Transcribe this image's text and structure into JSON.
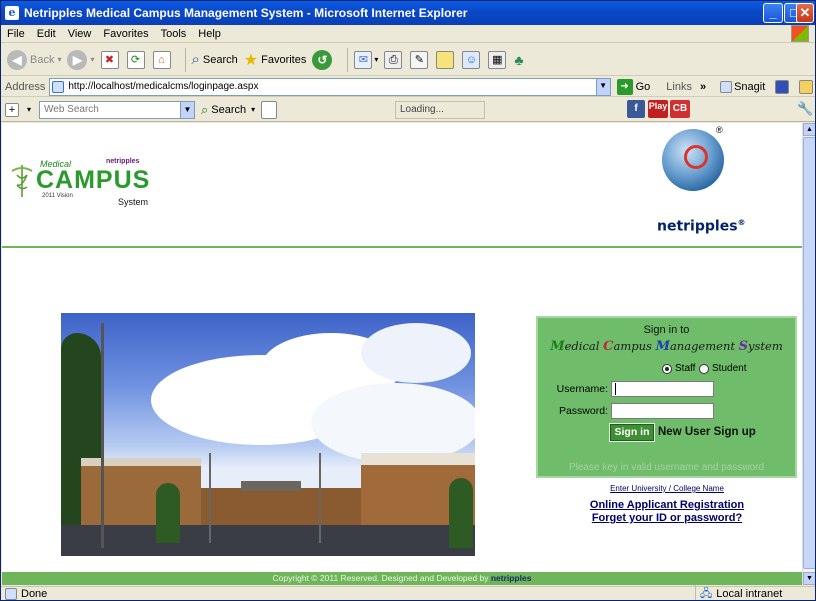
{
  "window": {
    "title": "Netripples Medical Campus Management System - Microsoft Internet Explorer",
    "minimize": "_",
    "maximize": "□",
    "close": "✕"
  },
  "menu": [
    "File",
    "Edit",
    "View",
    "Favorites",
    "Tools",
    "Help"
  ],
  "toolbar": {
    "back": "Back",
    "search": "Search",
    "favorites": "Favorites"
  },
  "address": {
    "label": "Address",
    "url": "http://localhost/medicalcms/loginpage.aspx",
    "go": "Go",
    "links": "Links",
    "more": "»",
    "snagit": "Snagit"
  },
  "searchbar": {
    "placeholder": "Web Search",
    "search": "Search",
    "loading": "Loading...",
    "play": "Play",
    "cb": "CB",
    "fb": "f"
  },
  "page": {
    "logo": {
      "medical": "Medical",
      "netripples": "netripples",
      "campus": "CAMPUS",
      "version": "2011 Vision",
      "system": "System"
    },
    "brand": "netripples",
    "reg": "®",
    "login": {
      "signin": "Sign in to",
      "title_parts": [
        "M",
        "edical ",
        "C",
        "ampus ",
        "M",
        "anagement ",
        "S",
        "ystem"
      ],
      "staff": "Staff",
      "student": "Student",
      "username_label": "Username:",
      "password_label": "Password:",
      "signin_button": "Sign in",
      "new_user": "New User Sign up",
      "hint": "Please key in valid username and password"
    },
    "links": {
      "enter": "Enter University / College Name",
      "online": "Online Applicant Registration",
      "forgot": "Forget your ID or password?"
    },
    "footer": {
      "text": "Copyright © 2011 Reserved. Designed and Developed by ",
      "brand": "netripples"
    }
  },
  "status": {
    "left": "Done",
    "zone": "Local intranet"
  },
  "colors": {
    "green_accent": "#6fb55a",
    "login_bg": "#6fbd6a",
    "link": "#00006b",
    "title_m": "#1a7d1a",
    "title_c": "#c0282d",
    "title_m2": "#1c3fb0",
    "title_s": "#6b2ba0"
  }
}
